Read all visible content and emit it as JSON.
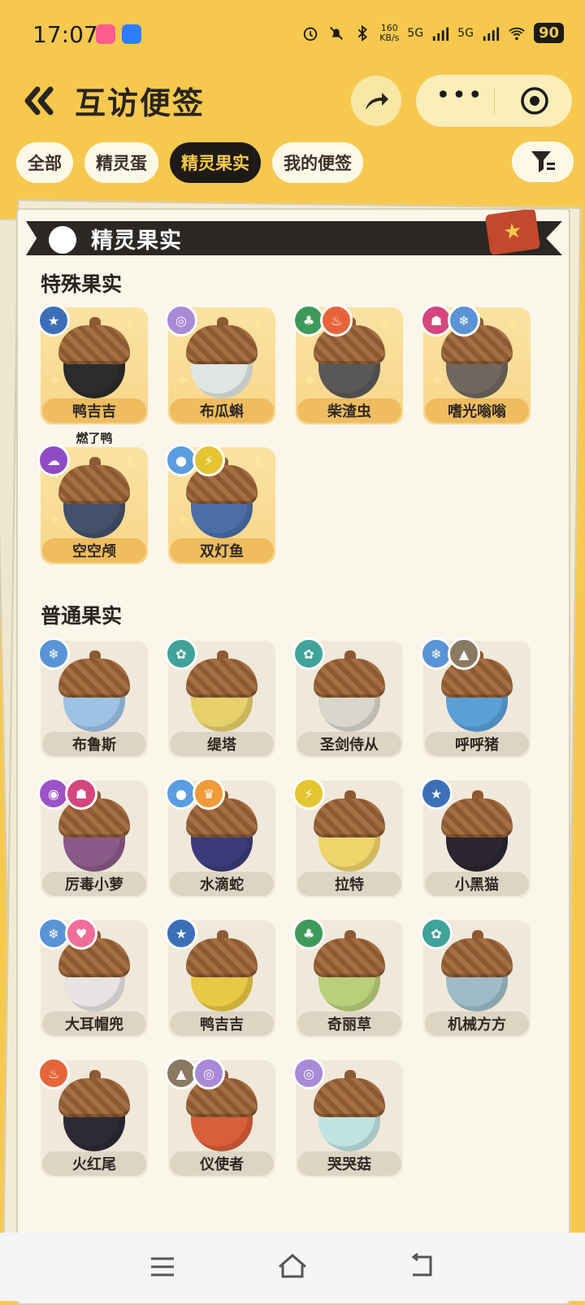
{
  "status": {
    "time": "17:07",
    "net_speed_top": "160",
    "net_speed_unit": "KB/s",
    "net1": "5G",
    "net2": "5G",
    "battery": "90"
  },
  "header": {
    "title": "互访便签"
  },
  "tabs": [
    {
      "label": "全部",
      "active": false
    },
    {
      "label": "精灵蛋",
      "active": false
    },
    {
      "label": "精灵果实",
      "active": true
    },
    {
      "label": "我的便签",
      "active": false
    }
  ],
  "card": {
    "banner_title": "精灵果实"
  },
  "special": {
    "title": "特殊果实",
    "items": [
      {
        "name": "鸭吉吉",
        "note": "燃了鸭",
        "nut": "#2c2c2c",
        "badges": [
          {
            "icon": "star-icon",
            "color": "#3c6fb7"
          }
        ]
      },
      {
        "name": "布瓜蝌",
        "nut": "#dfe6e2",
        "badges": [
          {
            "icon": "swirl-icon",
            "color": "#a98ad7"
          }
        ]
      },
      {
        "name": "柴渣虫",
        "nut": "#5a5856",
        "badges": [
          {
            "icon": "leaf-icon",
            "color": "#3f9a5a"
          },
          {
            "icon": "fire-icon",
            "color": "#e7643a"
          }
        ]
      },
      {
        "name": "嗜光嗡嗡",
        "nut": "#6f675d",
        "badges": [
          {
            "icon": "demon-icon",
            "color": "#d4467d"
          },
          {
            "icon": "ice-icon",
            "color": "#5a93d6"
          }
        ]
      },
      {
        "name": "空空颅",
        "nut": "#45506a",
        "badges": [
          {
            "icon": "ghost-icon",
            "color": "#8f4bc5"
          }
        ]
      },
      {
        "name": "双灯鱼",
        "nut": "#4c6ea8",
        "badges": [
          {
            "icon": "water-icon",
            "color": "#5a9de0"
          },
          {
            "icon": "electric-icon",
            "color": "#e4c531"
          }
        ]
      }
    ]
  },
  "normal": {
    "title": "普通果实",
    "items": [
      {
        "name": "布鲁斯",
        "nut": "#9dc2e4",
        "badges": [
          {
            "icon": "ice-icon",
            "color": "#5a93d6"
          }
        ]
      },
      {
        "name": "缇塔",
        "nut": "#e7d06a",
        "badges": [
          {
            "icon": "gear-icon",
            "color": "#3fa39a"
          }
        ]
      },
      {
        "name": "圣剑侍从",
        "nut": "#d9d6cc",
        "badges": [
          {
            "icon": "gear-icon",
            "color": "#3fa39a"
          }
        ]
      },
      {
        "name": "呼呼猪",
        "nut": "#5aa0d6",
        "badges": [
          {
            "icon": "ice-icon",
            "color": "#5a93d6"
          },
          {
            "icon": "mountain-icon",
            "color": "#8a7a62"
          }
        ]
      },
      {
        "name": "厉毒小萝",
        "nut": "#8a5a88",
        "badges": [
          {
            "icon": "poison-icon",
            "color": "#9c53c7"
          },
          {
            "icon": "demon-icon",
            "color": "#d4467d"
          }
        ]
      },
      {
        "name": "水滴蛇",
        "nut": "#3c3c7c",
        "badges": [
          {
            "icon": "water-icon",
            "color": "#5a9de0"
          },
          {
            "icon": "cake-icon",
            "color": "#f09a3a"
          }
        ]
      },
      {
        "name": "拉特",
        "nut": "#eed46a",
        "badges": [
          {
            "icon": "electric-icon",
            "color": "#e4c531"
          }
        ]
      },
      {
        "name": "小黑猫",
        "nut": "#2b2630",
        "badges": [
          {
            "icon": "star-icon",
            "color": "#3c6fb7"
          }
        ]
      },
      {
        "name": "大耳帽兜",
        "nut": "#e8e3e2",
        "badges": [
          {
            "icon": "ice-icon",
            "color": "#5a93d6"
          },
          {
            "icon": "heart-icon",
            "color": "#ef6e98"
          }
        ]
      },
      {
        "name": "鸭吉吉",
        "nut": "#e8c845",
        "badges": [
          {
            "icon": "star-icon",
            "color": "#3c6fb7"
          }
        ]
      },
      {
        "name": "奇丽草",
        "nut": "#b8d07a",
        "badges": [
          {
            "icon": "leaf-icon",
            "color": "#3f9a5a"
          }
        ]
      },
      {
        "name": "机械方方",
        "nut": "#9fbcc6",
        "badges": [
          {
            "icon": "gear-icon",
            "color": "#3fa39a"
          }
        ]
      },
      {
        "name": "火红尾",
        "nut": "#2e2a35",
        "badges": [
          {
            "icon": "fire-icon",
            "color": "#e7643a"
          }
        ]
      },
      {
        "name": "仪使者",
        "nut": "#d95e3a",
        "badges": [
          {
            "icon": "mountain-icon",
            "color": "#8a7a62"
          },
          {
            "icon": "swirl-icon",
            "color": "#a98ad7"
          }
        ]
      },
      {
        "name": "哭哭菇",
        "nut": "#bfe3e2",
        "badges": [
          {
            "icon": "swirl-icon",
            "color": "#a98ad7"
          }
        ]
      }
    ]
  }
}
